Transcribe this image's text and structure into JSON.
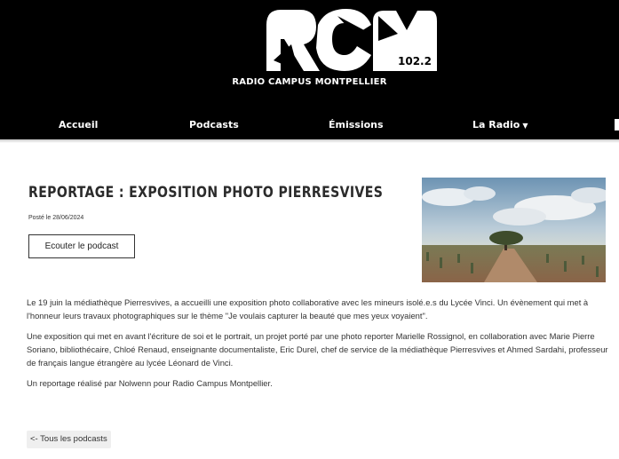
{
  "header": {
    "logo_frequency": "102.2",
    "station_name": "RADIO CAMPUS MONTPELLIER"
  },
  "nav": {
    "items": [
      {
        "label": "Accueil"
      },
      {
        "label": "Podcasts"
      },
      {
        "label": "Émissions"
      },
      {
        "label": "La Radio"
      }
    ],
    "dropdown_icon": "chevron-down-icon"
  },
  "article": {
    "title": "REPORTAGE : EXPOSITION PHOTO PIERRESVIVES",
    "posted": "Posté le 28/06/2024",
    "listen_button": "Ecouter le podcast",
    "paragraphs": [
      "Le 19 juin la médiathèque Pierresvives, a accueilli une exposition photo collaborative avec les mineurs isolé.e.s du Lycée Vinci. Un évènement qui met à l'honneur leurs travaux photographiques sur le thème \"Je voulais capturer la beauté que mes yeux voyaient\".",
      "Une exposition qui met en avant l'écriture de soi et le portrait, un projet porté par une photo reporter Marielle Rossignol, en collaboration avec Marie Pierre Soriano, bibliothécaire, Chloé Renaud, enseignante documentaliste, Eric Durel, chef de service de la médiathèque Pierresvives et Ahmed Sardahi, professeur de français langue étrangère au lycée Léonard de Vinci.",
      "Un reportage réalisé par Nolwenn pour Radio Campus Montpellier."
    ],
    "back_link": "<- Tous les podcasts"
  },
  "colors": {
    "header_bg": "#000000",
    "text": "#333333"
  }
}
